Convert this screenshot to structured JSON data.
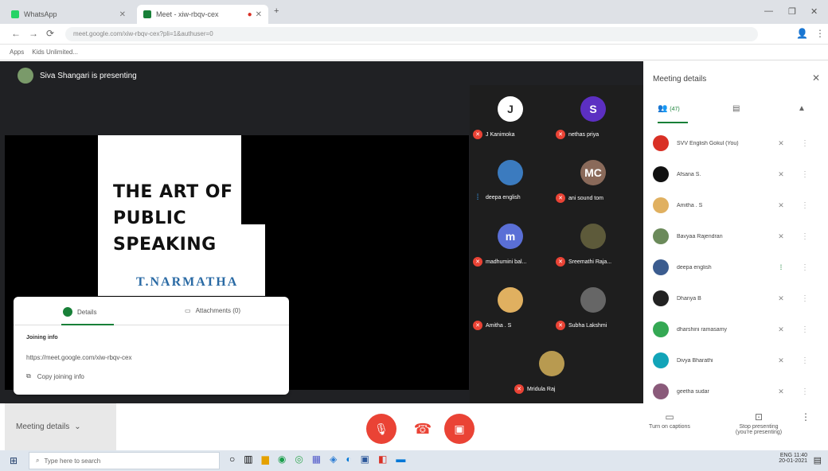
{
  "browser": {
    "tabs": [
      {
        "label": "WhatsApp",
        "color": "#25d366"
      },
      {
        "label": "Meet - xiw-rbqv-cex",
        "color": "#188038"
      }
    ],
    "url": "meet.google.com/xiw-rbqv-cex?pli=1&authuser=0",
    "bookmarks": [
      "Apps",
      "Kids Unlimited..."
    ],
    "window_controls": [
      "—",
      "❐",
      "✕"
    ]
  },
  "meeting": {
    "presenter_text": "Siva Shangari is presenting",
    "slide": {
      "title_lines": [
        "THE ART OF",
        "PUBLIC",
        "SPEAKING"
      ],
      "author": "T.NARMATHA"
    },
    "tiles": [
      {
        "name": "J Kanimoka",
        "initial": "J",
        "color": "#ffffff",
        "text_color": "#333",
        "muted": true
      },
      {
        "name": "nethas priya",
        "initial": "S",
        "color": "#5c2fc2",
        "text_color": "#fff",
        "muted": true
      },
      {
        "name": "deepa english",
        "initial": "",
        "color": "#3b7bbf",
        "text_color": "#fff",
        "muted": false
      },
      {
        "name": "ani sound tom",
        "initial": "MC",
        "color": "#8a6a5a",
        "text_color": "#fff",
        "muted": true
      },
      {
        "name": "madhumini bal...",
        "initial": "m",
        "color": "#5a6fd6",
        "text_color": "#fff",
        "muted": true
      },
      {
        "name": "Sreemathi Raja...",
        "initial": "",
        "color": "#5d5a3a",
        "text_color": "#fff",
        "muted": true
      },
      {
        "name": "Amitha . S",
        "initial": "",
        "color": "#e0b060",
        "text_color": "#fff",
        "muted": true
      },
      {
        "name": "Subha Lakshmi",
        "initial": "",
        "color": "#666666",
        "text_color": "#fff",
        "muted": true
      },
      {
        "name": "Mridula Raj",
        "initial": "",
        "color": "#b89a50",
        "text_color": "#fff",
        "muted": true
      }
    ]
  },
  "details_card": {
    "tab_details": "Details",
    "tab_attachments": "Attachments (0)",
    "heading": "Joining info",
    "link": "https://meet.google.com/xiw-rbqv-cex",
    "copy": "Copy joining info"
  },
  "controls": {
    "meeting_details": "Meeting details",
    "captions": "Turn on captions",
    "present": "Stop presenting (you're presenting)"
  },
  "panel": {
    "title": "Meeting details",
    "people_tab": "(47)",
    "participants": [
      {
        "name": "SVV English Gokul (You)",
        "color": "#d93025",
        "mic": "off"
      },
      {
        "name": "Afsana S.",
        "color": "#111111",
        "mic": "off"
      },
      {
        "name": "Amitha . S",
        "color": "#e0b060",
        "mic": "off"
      },
      {
        "name": "Bavyaa Rajendran",
        "color": "#6b8a5a",
        "mic": "off"
      },
      {
        "name": "deepa english",
        "color": "#3b5c8f",
        "mic": "on"
      },
      {
        "name": "Dhanya B",
        "color": "#222222",
        "mic": "off"
      },
      {
        "name": "dharshini ramasamy",
        "color": "#34a853",
        "mic": "off"
      },
      {
        "name": "Divya Bharathi",
        "color": "#12a4b8",
        "mic": "off"
      },
      {
        "name": "geetha sudar",
        "color": "#8a5a7a",
        "mic": "off"
      }
    ]
  },
  "taskbar": {
    "search_placeholder": "Type here to search",
    "time": "11:40",
    "date": "20-01-2021",
    "lang": "ENG"
  }
}
